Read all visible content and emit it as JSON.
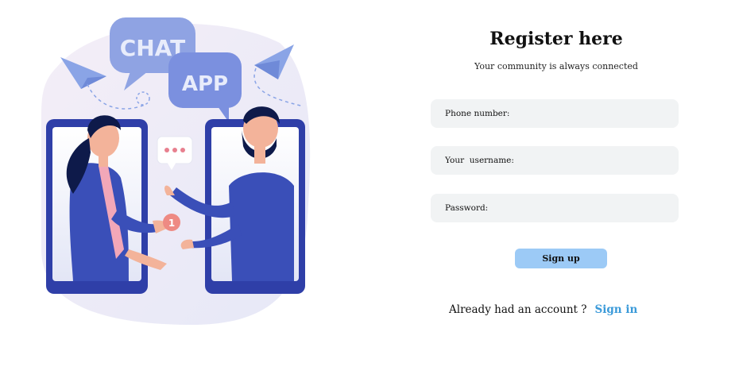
{
  "illustration": {
    "bubble_chat_text": "CHAT",
    "bubble_app_text": "APP",
    "badge_text": "1"
  },
  "form": {
    "title": "Register here",
    "subtitle": "Your community is always connected",
    "phone_placeholder": "Phone number:",
    "username_placeholder": "Your  username:",
    "password_placeholder": "Password:",
    "signup_label": "Sign up",
    "already_text": "Already had an account ?",
    "signin_label": "Sign in"
  },
  "colors": {
    "field_bg": "#f1f3f4",
    "button_bg": "#9ccaf6",
    "link": "#3a9ad9",
    "phone_frame": "#2f3fa8"
  }
}
